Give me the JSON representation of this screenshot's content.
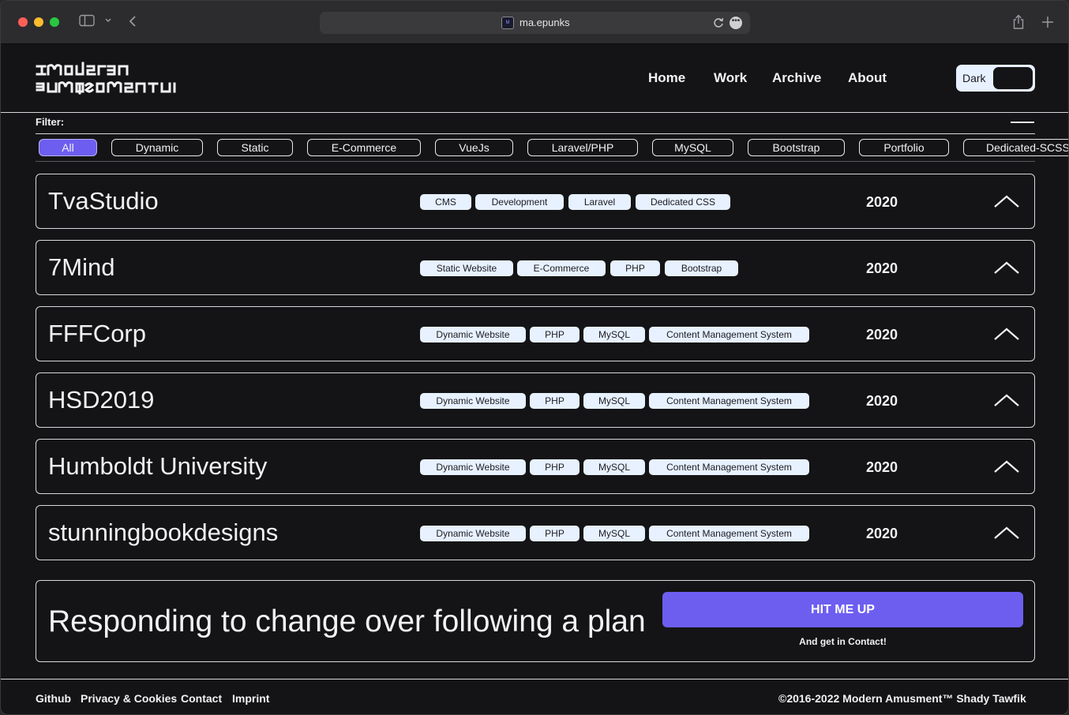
{
  "browser": {
    "url": "ma.epunks",
    "favicon_text": "M"
  },
  "site": {
    "nav": [
      "Home",
      "Work",
      "Archive",
      "About"
    ],
    "theme_toggle_label": "Dark",
    "filter_label": "Filter:",
    "filters": [
      {
        "label": "All",
        "active": true
      },
      {
        "label": "Dynamic",
        "active": false
      },
      {
        "label": "Static",
        "active": false
      },
      {
        "label": "E-Commerce",
        "active": false
      },
      {
        "label": "VueJs",
        "active": false
      },
      {
        "label": "Laravel/PHP",
        "active": false
      },
      {
        "label": "MySQL",
        "active": false
      },
      {
        "label": "Bootstrap",
        "active": false
      },
      {
        "label": "Portfolio",
        "active": false
      },
      {
        "label": "Dedicated-SCSS",
        "active": false
      }
    ],
    "projects": [
      {
        "name": "TvaStudio",
        "tags": [
          "CMS",
          "Development",
          "Laravel",
          "Dedicated CSS"
        ],
        "year": "2020"
      },
      {
        "name": "7Mind",
        "tags": [
          "Static Website",
          "E-Commerce",
          "PHP",
          "Bootstrap"
        ],
        "year": "2020"
      },
      {
        "name": "FFFCorp",
        "tags": [
          "Dynamic Website",
          "PHP",
          "MySQL",
          "Content Management System"
        ],
        "year": "2020"
      },
      {
        "name": "HSD2019",
        "tags": [
          "Dynamic Website",
          "PHP",
          "MySQL",
          "Content Management System"
        ],
        "year": "2020"
      },
      {
        "name": "Humboldt University",
        "tags": [
          "Dynamic Website",
          "PHP",
          "MySQL",
          "Content Management System"
        ],
        "year": "2020"
      },
      {
        "name": "stunningbookdesigns",
        "tags": [
          "Dynamic Website",
          "PHP",
          "MySQL",
          "Content Management System"
        ],
        "year": "2020"
      }
    ],
    "cta": {
      "heading": "Responding to change over following a plan",
      "button": "HIT ME UP",
      "subtext": "And get in Contact!"
    },
    "footer": {
      "links": [
        "Github",
        "Privacy & Cookies",
        "Contact",
        "Imprint"
      ],
      "copyright_years": "©2016-2022",
      "copyright_owner": "Modern Amusment™ Shady Tawfik"
    },
    "colors": {
      "background": "#141416",
      "accent": "#6d5ef0",
      "tag_bg": "#e7f1ff",
      "text": "#f2f2f4"
    }
  }
}
